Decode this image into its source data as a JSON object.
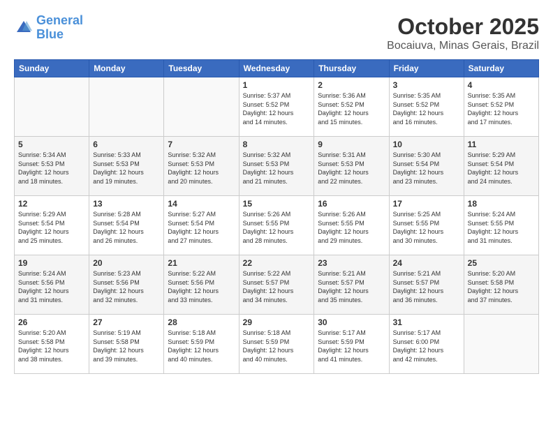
{
  "logo": {
    "line1": "General",
    "line2": "Blue"
  },
  "title": "October 2025",
  "location": "Bocaiuva, Minas Gerais, Brazil",
  "days_of_week": [
    "Sunday",
    "Monday",
    "Tuesday",
    "Wednesday",
    "Thursday",
    "Friday",
    "Saturday"
  ],
  "weeks": [
    [
      {
        "day": "",
        "info": ""
      },
      {
        "day": "",
        "info": ""
      },
      {
        "day": "",
        "info": ""
      },
      {
        "day": "1",
        "info": "Sunrise: 5:37 AM\nSunset: 5:52 PM\nDaylight: 12 hours\nand 14 minutes."
      },
      {
        "day": "2",
        "info": "Sunrise: 5:36 AM\nSunset: 5:52 PM\nDaylight: 12 hours\nand 15 minutes."
      },
      {
        "day": "3",
        "info": "Sunrise: 5:35 AM\nSunset: 5:52 PM\nDaylight: 12 hours\nand 16 minutes."
      },
      {
        "day": "4",
        "info": "Sunrise: 5:35 AM\nSunset: 5:52 PM\nDaylight: 12 hours\nand 17 minutes."
      }
    ],
    [
      {
        "day": "5",
        "info": "Sunrise: 5:34 AM\nSunset: 5:53 PM\nDaylight: 12 hours\nand 18 minutes."
      },
      {
        "day": "6",
        "info": "Sunrise: 5:33 AM\nSunset: 5:53 PM\nDaylight: 12 hours\nand 19 minutes."
      },
      {
        "day": "7",
        "info": "Sunrise: 5:32 AM\nSunset: 5:53 PM\nDaylight: 12 hours\nand 20 minutes."
      },
      {
        "day": "8",
        "info": "Sunrise: 5:32 AM\nSunset: 5:53 PM\nDaylight: 12 hours\nand 21 minutes."
      },
      {
        "day": "9",
        "info": "Sunrise: 5:31 AM\nSunset: 5:53 PM\nDaylight: 12 hours\nand 22 minutes."
      },
      {
        "day": "10",
        "info": "Sunrise: 5:30 AM\nSunset: 5:54 PM\nDaylight: 12 hours\nand 23 minutes."
      },
      {
        "day": "11",
        "info": "Sunrise: 5:29 AM\nSunset: 5:54 PM\nDaylight: 12 hours\nand 24 minutes."
      }
    ],
    [
      {
        "day": "12",
        "info": "Sunrise: 5:29 AM\nSunset: 5:54 PM\nDaylight: 12 hours\nand 25 minutes."
      },
      {
        "day": "13",
        "info": "Sunrise: 5:28 AM\nSunset: 5:54 PM\nDaylight: 12 hours\nand 26 minutes."
      },
      {
        "day": "14",
        "info": "Sunrise: 5:27 AM\nSunset: 5:54 PM\nDaylight: 12 hours\nand 27 minutes."
      },
      {
        "day": "15",
        "info": "Sunrise: 5:26 AM\nSunset: 5:55 PM\nDaylight: 12 hours\nand 28 minutes."
      },
      {
        "day": "16",
        "info": "Sunrise: 5:26 AM\nSunset: 5:55 PM\nDaylight: 12 hours\nand 29 minutes."
      },
      {
        "day": "17",
        "info": "Sunrise: 5:25 AM\nSunset: 5:55 PM\nDaylight: 12 hours\nand 30 minutes."
      },
      {
        "day": "18",
        "info": "Sunrise: 5:24 AM\nSunset: 5:55 PM\nDaylight: 12 hours\nand 31 minutes."
      }
    ],
    [
      {
        "day": "19",
        "info": "Sunrise: 5:24 AM\nSunset: 5:56 PM\nDaylight: 12 hours\nand 31 minutes."
      },
      {
        "day": "20",
        "info": "Sunrise: 5:23 AM\nSunset: 5:56 PM\nDaylight: 12 hours\nand 32 minutes."
      },
      {
        "day": "21",
        "info": "Sunrise: 5:22 AM\nSunset: 5:56 PM\nDaylight: 12 hours\nand 33 minutes."
      },
      {
        "day": "22",
        "info": "Sunrise: 5:22 AM\nSunset: 5:57 PM\nDaylight: 12 hours\nand 34 minutes."
      },
      {
        "day": "23",
        "info": "Sunrise: 5:21 AM\nSunset: 5:57 PM\nDaylight: 12 hours\nand 35 minutes."
      },
      {
        "day": "24",
        "info": "Sunrise: 5:21 AM\nSunset: 5:57 PM\nDaylight: 12 hours\nand 36 minutes."
      },
      {
        "day": "25",
        "info": "Sunrise: 5:20 AM\nSunset: 5:58 PM\nDaylight: 12 hours\nand 37 minutes."
      }
    ],
    [
      {
        "day": "26",
        "info": "Sunrise: 5:20 AM\nSunset: 5:58 PM\nDaylight: 12 hours\nand 38 minutes."
      },
      {
        "day": "27",
        "info": "Sunrise: 5:19 AM\nSunset: 5:58 PM\nDaylight: 12 hours\nand 39 minutes."
      },
      {
        "day": "28",
        "info": "Sunrise: 5:18 AM\nSunset: 5:59 PM\nDaylight: 12 hours\nand 40 minutes."
      },
      {
        "day": "29",
        "info": "Sunrise: 5:18 AM\nSunset: 5:59 PM\nDaylight: 12 hours\nand 40 minutes."
      },
      {
        "day": "30",
        "info": "Sunrise: 5:17 AM\nSunset: 5:59 PM\nDaylight: 12 hours\nand 41 minutes."
      },
      {
        "day": "31",
        "info": "Sunrise: 5:17 AM\nSunset: 6:00 PM\nDaylight: 12 hours\nand 42 minutes."
      },
      {
        "day": "",
        "info": ""
      }
    ]
  ]
}
